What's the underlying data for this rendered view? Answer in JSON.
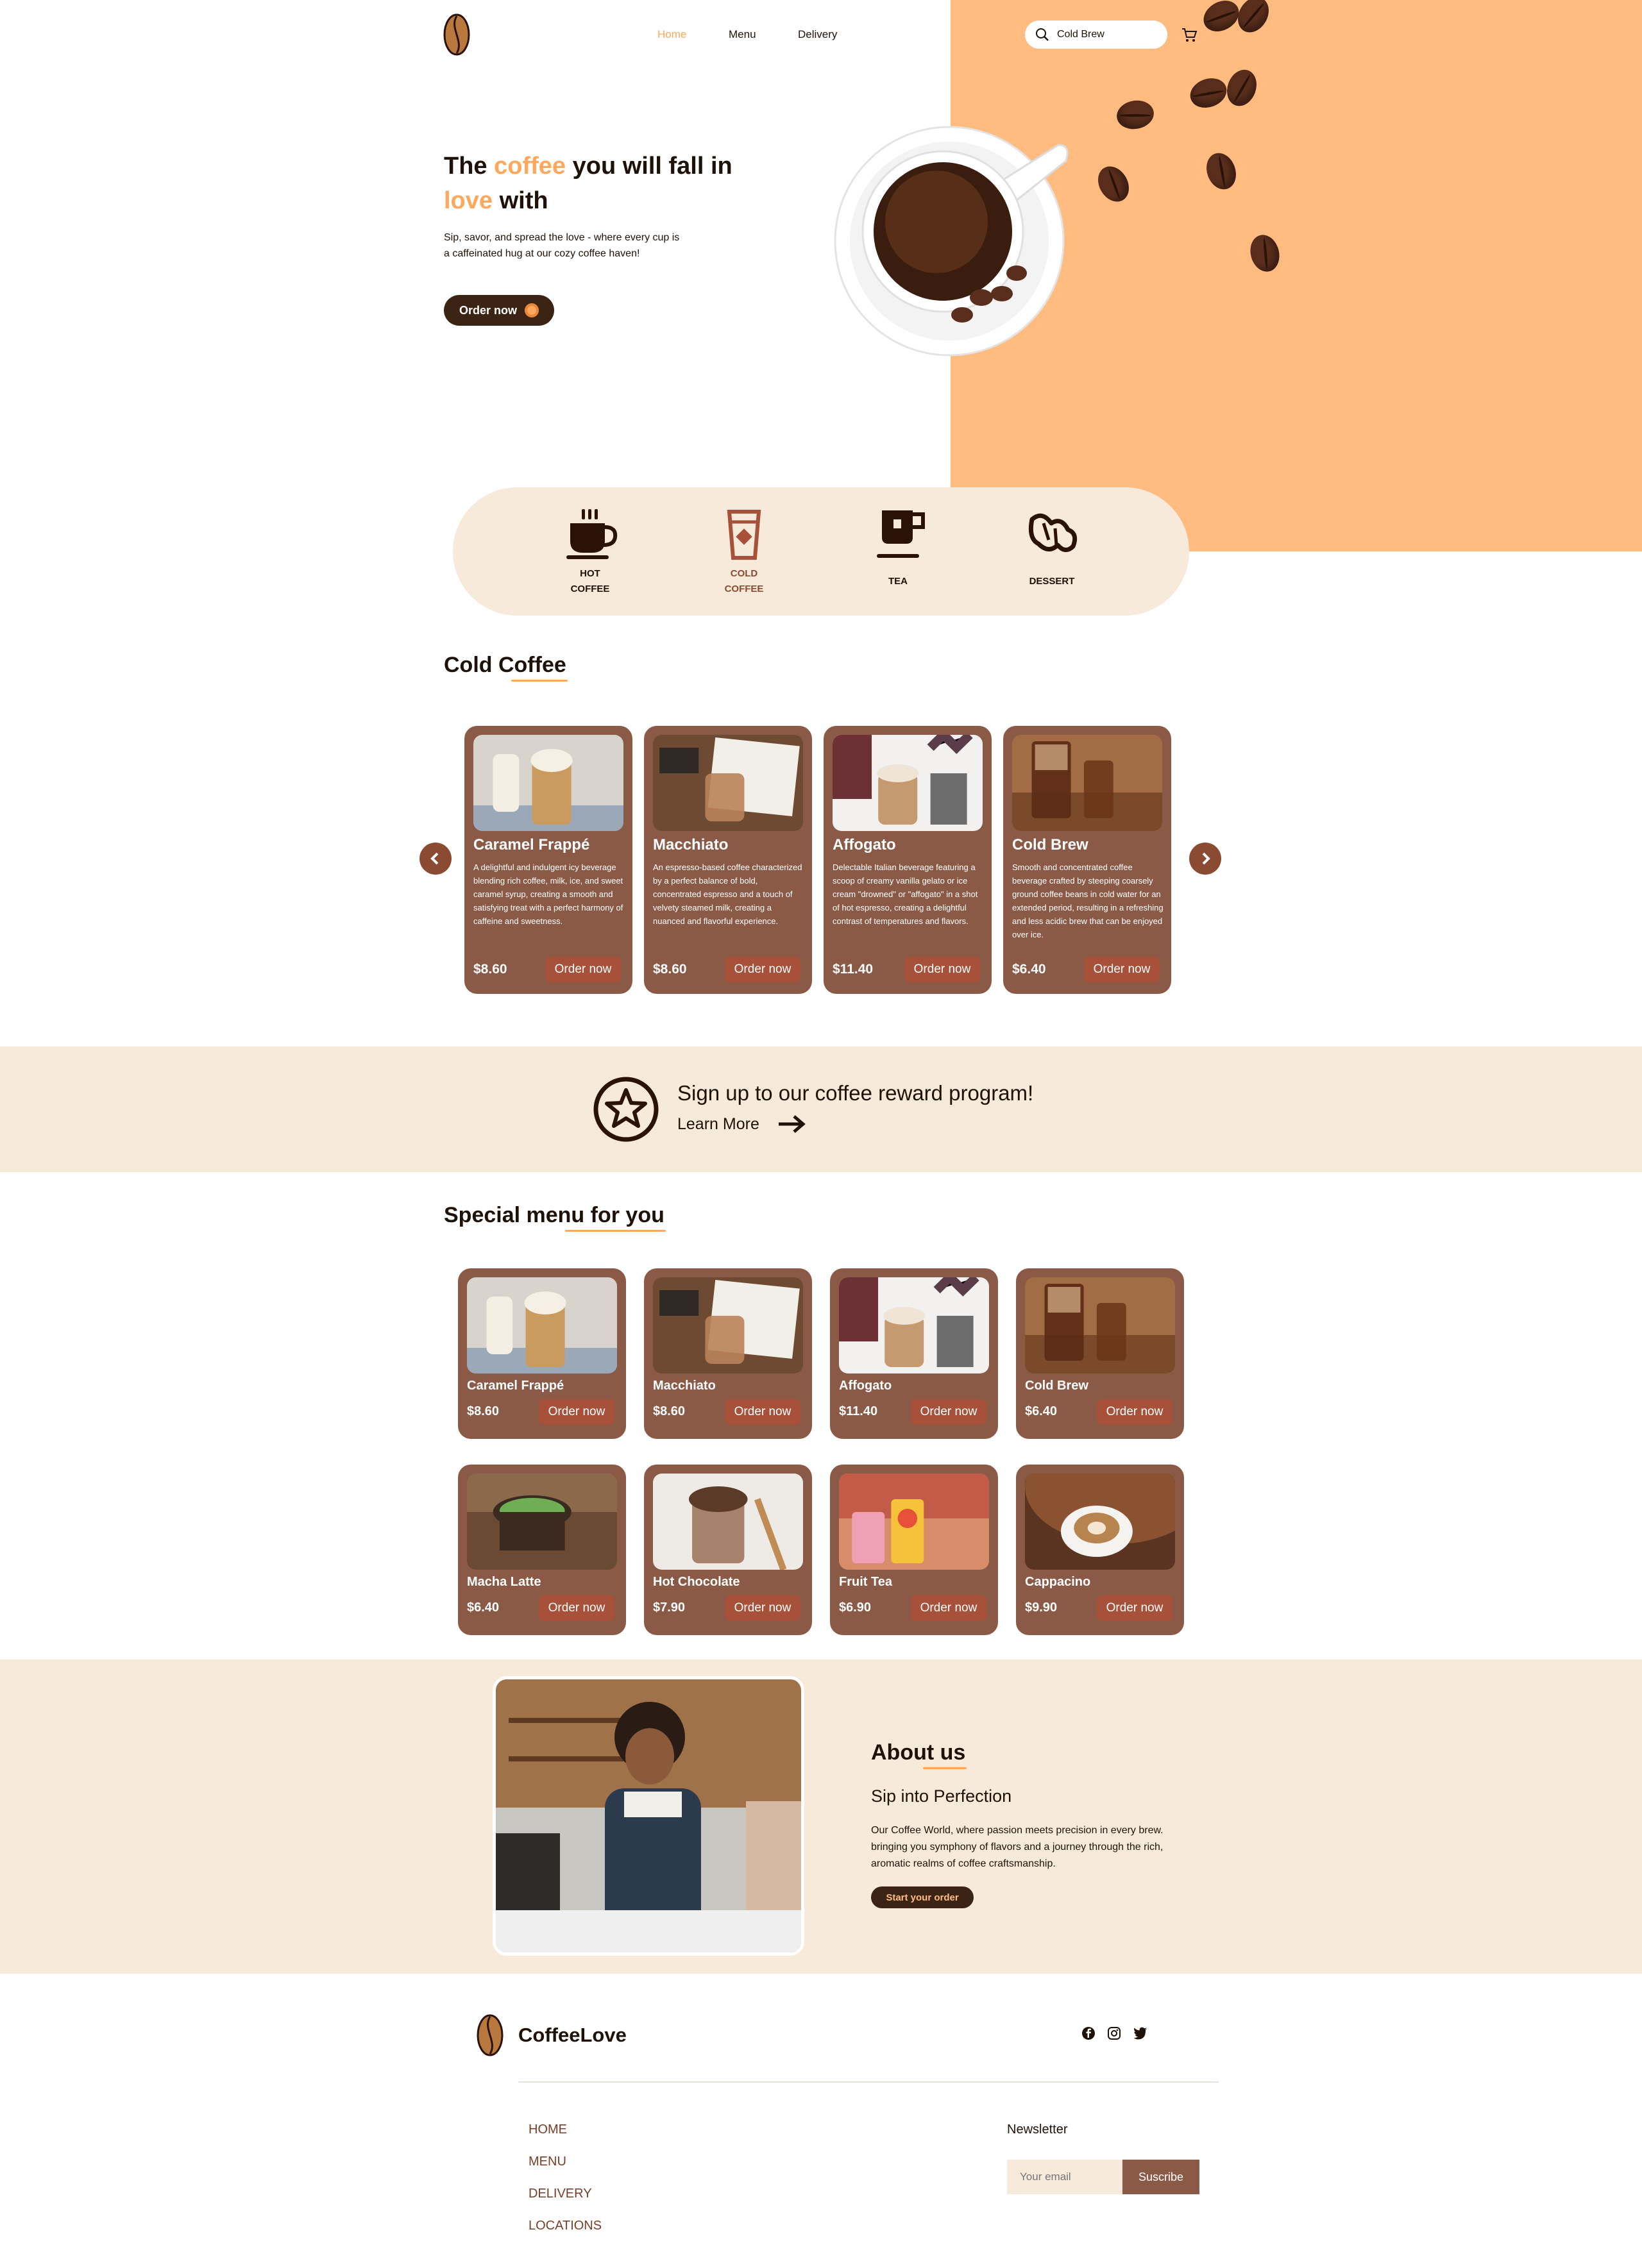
{
  "nav": {
    "home": "Home",
    "menu": "Menu",
    "delivery": "Delivery",
    "search_value": "Cold Brew"
  },
  "hero": {
    "title_1": "The ",
    "title_accent_1": "coffee",
    "title_2": " you will fall in",
    "title_accent_2": "love",
    "title_3": " with",
    "subtitle": "Sip, savor, and spread the love - where every cup is a caffeinated hug at our cozy coffee haven!",
    "cta": "Order now"
  },
  "categories": [
    {
      "line1": "HOT",
      "line2": "COFFEE",
      "icon": "hot-coffee-icon"
    },
    {
      "line1": "COLD",
      "line2": "COFFEE",
      "icon": "cold-coffee-icon"
    },
    {
      "line1": "TEA",
      "line2": "",
      "icon": "tea-icon"
    },
    {
      "line1": "DESSERT",
      "line2": "",
      "icon": "dessert-icon"
    }
  ],
  "cold_section": {
    "title": "Cold Coffee",
    "items": [
      {
        "name": "Caramel Frappé",
        "desc": "A delightful and indulgent icy beverage blending rich coffee, milk, ice, and sweet caramel syrup, creating a smooth and satisfying treat with a perfect harmony of caffeine and sweetness.",
        "price": "$8.60",
        "cta": "Order now"
      },
      {
        "name": "Macchiato",
        "desc": "An espresso-based coffee characterized by a perfect balance of bold, concentrated espresso and a touch of velvety steamed milk, creating a nuanced and flavorful experience.",
        "price": "$8.60",
        "cta": "Order now"
      },
      {
        "name": "Affogato",
        "desc": "Delectable Italian beverage featuring a scoop of creamy vanilla gelato or ice cream \"drowned\" or \"affogato\" in a shot of hot espresso, creating a delightful contrast of temperatures and flavors.",
        "price": "$11.40",
        "cta": "Order now"
      },
      {
        "name": "Cold Brew",
        "desc": "Smooth and concentrated coffee beverage crafted by steeping coarsely ground coffee beans in cold water for an extended period, resulting in a refreshing and less acidic brew that can be enjoyed over ice.",
        "price": "$6.40",
        "cta": "Order now"
      }
    ]
  },
  "reward": {
    "title": "Sign up to our coffee reward program!",
    "link": "Learn More"
  },
  "special": {
    "title": "Special menu for you",
    "items": [
      {
        "name": "Caramel Frappé",
        "price": "$8.60",
        "cta": "Order now"
      },
      {
        "name": "Macchiato",
        "price": "$8.60",
        "cta": "Order now"
      },
      {
        "name": "Affogato",
        "price": "$11.40",
        "cta": "Order now"
      },
      {
        "name": "Cold Brew",
        "price": "$6.40",
        "cta": "Order now"
      },
      {
        "name": "Macha Latte",
        "price": "$6.40",
        "cta": "Order now"
      },
      {
        "name": "Hot Chocolate",
        "price": "$7.90",
        "cta": "Order now"
      },
      {
        "name": "Fruit Tea",
        "price": "$6.90",
        "cta": "Order now"
      },
      {
        "name": "Cappacino",
        "price": "$9.90",
        "cta": "Order now"
      }
    ]
  },
  "about": {
    "title": "About us",
    "subtitle": "Sip into Perfection",
    "text": "Our Coffee World, where passion meets precision in every brew. bringing you symphony of flavors and a journey through the rich, aromatic realms of coffee craftsmanship.",
    "cta": "Start your order"
  },
  "footer": {
    "brand": "CoffeeLove",
    "links": [
      "HOME",
      "MENU",
      "DELIVERY",
      "LOCATIONS"
    ],
    "newsletter_title": "Newsletter",
    "email_placeholder": "Your email",
    "subscribe": "Suscribe"
  },
  "colors": {
    "accent": "#ffa75c",
    "peach": "#ffbb80",
    "cream": "#f7eadb",
    "card_brown": "#8b5a47",
    "button_red": "#a7513a",
    "dark": "#3b2414"
  }
}
